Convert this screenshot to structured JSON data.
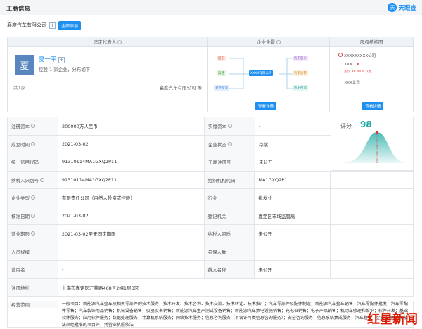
{
  "header": {
    "title": "工商信息",
    "logo_mark": "天",
    "logo_text": "天眼查"
  },
  "company": {
    "name": "襄度汽车有限公司",
    "add_label": "全部添加"
  },
  "panels": {
    "legal": {
      "title": "法定代表人",
      "avatar_char": "夏",
      "name": "夏一平",
      "desc": "控股 1 家企业，分布如下",
      "count": "共1家",
      "company": "襄度汽车有限公司 等"
    },
    "panorama": {
      "title": "企业全景",
      "nodes": [
        "股东",
        "高管",
        "对外投资",
        "XXXX有限公司",
        "历史股东",
        "历史高管",
        "历史投资"
      ],
      "detail_label": "查看详情"
    },
    "equity": {
      "title": "股权结构图",
      "top_company": "XXXXXXXXX公司",
      "line2": "XXX",
      "line3": "股比 XX.XX% 认缴",
      "bottom_company": "XXX公司",
      "detail_label": "查看详情"
    }
  },
  "score": {
    "label": "评分",
    "value": "98"
  },
  "rows": [
    {
      "l1": "注册资本",
      "v1": "200000万人民币",
      "l2": "实缴资本",
      "v2": "-"
    },
    {
      "l1": "成立时间",
      "v1": "2021-03-02",
      "l2": "企业状态",
      "v2": "存续"
    },
    {
      "l1": "统一信用代码",
      "v1": "91310114MA1GXQ2P11",
      "l2": "工商注册号",
      "v2": "未公开"
    },
    {
      "l1": "纳税人识别号",
      "v1": "91310114MA1GXQ2P11",
      "l2": "组织机构代码",
      "v2": "MA1GXQ2P1",
      "v3": ""
    },
    {
      "l1": "企业类型",
      "v1": "有限责任公司（自然人投资或控股）",
      "l2": "行业",
      "v2": "批发业",
      "v3": ""
    },
    {
      "l1": "核准日期",
      "v1": "2021-03-02",
      "l2": "登记机关",
      "v2": "嘉定区市场监管局",
      "v3": ""
    },
    {
      "l1": "营业期限",
      "v1": "2021-03-02至无固定期限",
      "l2": "纳税人资质",
      "v2": "未公开",
      "v3": ""
    },
    {
      "l1": "人员规模",
      "v1": "",
      "l2": "参保人数",
      "v2": "",
      "v3": ""
    },
    {
      "l1": "曾用名",
      "v1": "-",
      "l2": "英文名称",
      "v2": "未公开",
      "v3": ""
    }
  ],
  "address": {
    "label": "注册地址",
    "value": "上海市嘉定区汇荣路468号2幢1层B区"
  },
  "scope": {
    "label": "经营范围",
    "text": "一般项目：新能源汽车整车及相关零部件的技术服务，技术开发、技术咨询、技术交流、技术转让、技术推广；汽车零部件及配件制造；新能源汽车整车销售；汽车零配件批发；汽车零配件零售；汽车装饰用品销售；机械设备销售；仪器仪表销售；新能源汽车生产测试设备销售；新能源汽车换电设施销售；充电桩销售；电子产品销售；机动车修理和维护；软件开发；基础软件服务；应用软件服务；数据处理服务；计算机系统服务；网络技术服务；信息咨询服务（不含许可类信息咨询服务）；安全咨询服务；信息系统集成服务；汽车租赁；企业管理；（除依法须经批准的项目外，凭营业执照依法"
  },
  "watermark": "红星新闻"
}
